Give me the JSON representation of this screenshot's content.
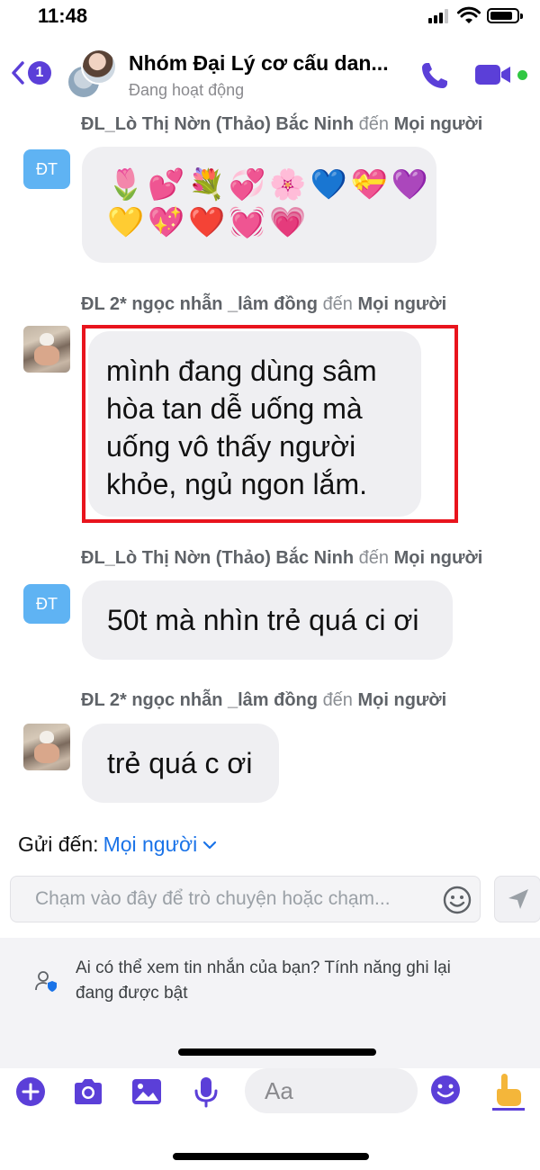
{
  "status_bar": {
    "time": "11:48"
  },
  "header": {
    "back_count": "1",
    "group_name": "Nhóm Đại Lý cơ cấu dan...",
    "status": "Đang hoạt động"
  },
  "messages": [
    {
      "sender": "ĐL_Lò Thị Nờn (Thảo) Bắc Ninh",
      "connector": "đến",
      "recipient": "Mọi người",
      "avatar_initials": "ĐT",
      "emoji_line_1": "🌷💕💐💞🌸💙💝💜",
      "emoji_line_2": "💛💖❤️💓💗"
    },
    {
      "sender": "ĐL 2* ngọc nhẫn _lâm đồng",
      "connector": "đến",
      "recipient": "Mọi người",
      "lines": [
        "mình đang dùng sâm",
        "hòa tan dễ uống mà",
        "uống vô thấy người",
        "khỏe, ngủ ngon lắm."
      ],
      "highlighted": true
    },
    {
      "sender": "ĐL_Lò Thị Nờn (Thảo) Bắc Ninh",
      "connector": "đến",
      "recipient": "Mọi người",
      "avatar_initials": "ĐT",
      "text": "50t mà nhìn trẻ quá ci ơi"
    },
    {
      "sender": "ĐL 2* ngọc nhẫn _lâm đồng",
      "connector": "đến",
      "recipient": "Mọi người",
      "text": "trẻ quá c ơi"
    }
  ],
  "composer": {
    "send_to_label": "Gửi đến:",
    "send_to_target": "Mọi người",
    "placeholder": "Chạm vào đây để trò chuyện hoặc chạm..."
  },
  "privacy_notice": {
    "line_1": "Ai có thể xem tin nhắn của bạn? Tính năng ghi lại",
    "line_2": "đang được bật"
  },
  "toolbar": {
    "input_label": "Aa"
  },
  "colors": {
    "accent": "#5b3fd8",
    "link": "#1a73e8",
    "highlight": "#e8141d",
    "bubble": "#efeff2",
    "online": "#31c742"
  },
  "icons": [
    "back-chevron-icon",
    "phone-icon",
    "video-camera-icon",
    "smiley-icon",
    "send-icon",
    "privacy-icon",
    "plus-icon",
    "camera-icon",
    "image-icon",
    "microphone-icon",
    "pointing-hand-icon"
  ]
}
